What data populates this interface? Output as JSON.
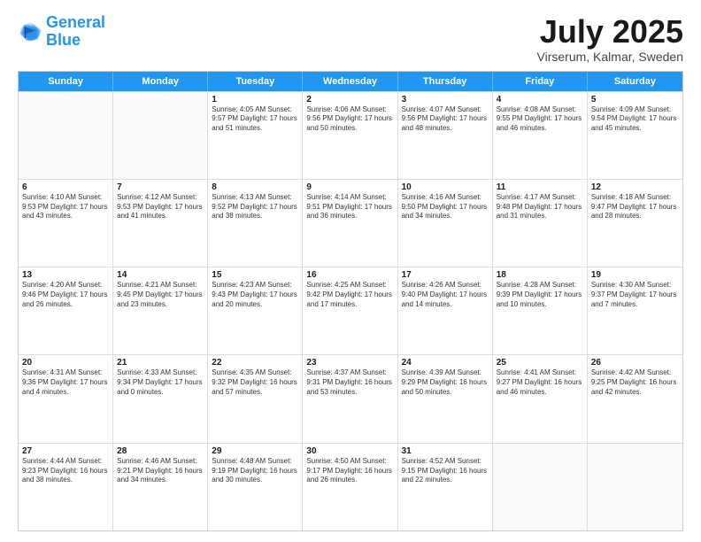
{
  "logo": {
    "line1": "General",
    "line2": "Blue"
  },
  "title": "July 2025",
  "subtitle": "Virserum, Kalmar, Sweden",
  "days_of_week": [
    "Sunday",
    "Monday",
    "Tuesday",
    "Wednesday",
    "Thursday",
    "Friday",
    "Saturday"
  ],
  "weeks": [
    [
      {
        "day": "",
        "info": ""
      },
      {
        "day": "",
        "info": ""
      },
      {
        "day": "1",
        "info": "Sunrise: 4:05 AM\nSunset: 9:57 PM\nDaylight: 17 hours and 51 minutes."
      },
      {
        "day": "2",
        "info": "Sunrise: 4:06 AM\nSunset: 9:56 PM\nDaylight: 17 hours and 50 minutes."
      },
      {
        "day": "3",
        "info": "Sunrise: 4:07 AM\nSunset: 9:56 PM\nDaylight: 17 hours and 48 minutes."
      },
      {
        "day": "4",
        "info": "Sunrise: 4:08 AM\nSunset: 9:55 PM\nDaylight: 17 hours and 46 minutes."
      },
      {
        "day": "5",
        "info": "Sunrise: 4:09 AM\nSunset: 9:54 PM\nDaylight: 17 hours and 45 minutes."
      }
    ],
    [
      {
        "day": "6",
        "info": "Sunrise: 4:10 AM\nSunset: 9:53 PM\nDaylight: 17 hours and 43 minutes."
      },
      {
        "day": "7",
        "info": "Sunrise: 4:12 AM\nSunset: 9:53 PM\nDaylight: 17 hours and 41 minutes."
      },
      {
        "day": "8",
        "info": "Sunrise: 4:13 AM\nSunset: 9:52 PM\nDaylight: 17 hours and 38 minutes."
      },
      {
        "day": "9",
        "info": "Sunrise: 4:14 AM\nSunset: 9:51 PM\nDaylight: 17 hours and 36 minutes."
      },
      {
        "day": "10",
        "info": "Sunrise: 4:16 AM\nSunset: 9:50 PM\nDaylight: 17 hours and 34 minutes."
      },
      {
        "day": "11",
        "info": "Sunrise: 4:17 AM\nSunset: 9:48 PM\nDaylight: 17 hours and 31 minutes."
      },
      {
        "day": "12",
        "info": "Sunrise: 4:18 AM\nSunset: 9:47 PM\nDaylight: 17 hours and 28 minutes."
      }
    ],
    [
      {
        "day": "13",
        "info": "Sunrise: 4:20 AM\nSunset: 9:46 PM\nDaylight: 17 hours and 26 minutes."
      },
      {
        "day": "14",
        "info": "Sunrise: 4:21 AM\nSunset: 9:45 PM\nDaylight: 17 hours and 23 minutes."
      },
      {
        "day": "15",
        "info": "Sunrise: 4:23 AM\nSunset: 9:43 PM\nDaylight: 17 hours and 20 minutes."
      },
      {
        "day": "16",
        "info": "Sunrise: 4:25 AM\nSunset: 9:42 PM\nDaylight: 17 hours and 17 minutes."
      },
      {
        "day": "17",
        "info": "Sunrise: 4:26 AM\nSunset: 9:40 PM\nDaylight: 17 hours and 14 minutes."
      },
      {
        "day": "18",
        "info": "Sunrise: 4:28 AM\nSunset: 9:39 PM\nDaylight: 17 hours and 10 minutes."
      },
      {
        "day": "19",
        "info": "Sunrise: 4:30 AM\nSunset: 9:37 PM\nDaylight: 17 hours and 7 minutes."
      }
    ],
    [
      {
        "day": "20",
        "info": "Sunrise: 4:31 AM\nSunset: 9:36 PM\nDaylight: 17 hours and 4 minutes."
      },
      {
        "day": "21",
        "info": "Sunrise: 4:33 AM\nSunset: 9:34 PM\nDaylight: 17 hours and 0 minutes."
      },
      {
        "day": "22",
        "info": "Sunrise: 4:35 AM\nSunset: 9:32 PM\nDaylight: 16 hours and 57 minutes."
      },
      {
        "day": "23",
        "info": "Sunrise: 4:37 AM\nSunset: 9:31 PM\nDaylight: 16 hours and 53 minutes."
      },
      {
        "day": "24",
        "info": "Sunrise: 4:39 AM\nSunset: 9:29 PM\nDaylight: 16 hours and 50 minutes."
      },
      {
        "day": "25",
        "info": "Sunrise: 4:41 AM\nSunset: 9:27 PM\nDaylight: 16 hours and 46 minutes."
      },
      {
        "day": "26",
        "info": "Sunrise: 4:42 AM\nSunset: 9:25 PM\nDaylight: 16 hours and 42 minutes."
      }
    ],
    [
      {
        "day": "27",
        "info": "Sunrise: 4:44 AM\nSunset: 9:23 PM\nDaylight: 16 hours and 38 minutes."
      },
      {
        "day": "28",
        "info": "Sunrise: 4:46 AM\nSunset: 9:21 PM\nDaylight: 16 hours and 34 minutes."
      },
      {
        "day": "29",
        "info": "Sunrise: 4:48 AM\nSunset: 9:19 PM\nDaylight: 16 hours and 30 minutes."
      },
      {
        "day": "30",
        "info": "Sunrise: 4:50 AM\nSunset: 9:17 PM\nDaylight: 16 hours and 26 minutes."
      },
      {
        "day": "31",
        "info": "Sunrise: 4:52 AM\nSunset: 9:15 PM\nDaylight: 16 hours and 22 minutes."
      },
      {
        "day": "",
        "info": ""
      },
      {
        "day": "",
        "info": ""
      }
    ]
  ]
}
